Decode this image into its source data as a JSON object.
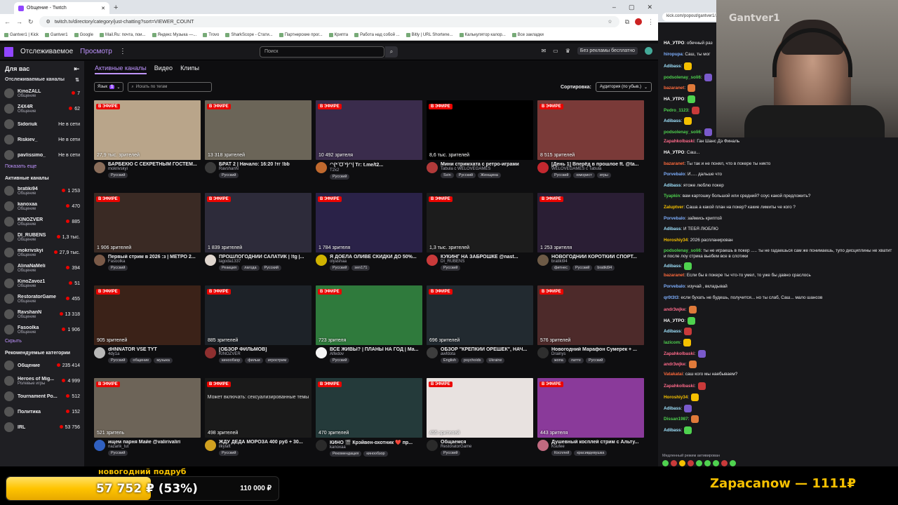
{
  "browser": {
    "tab_title": "Общение - Twitch",
    "url": "twitch.tv/directory/category/just-chatting?sort=VIEWER_COUNT",
    "bookmarks": [
      "Gantver1 | Kick",
      "Gantver1",
      "Google",
      "Mail.Ru: почта, пои...",
      "Яндекс Музыка —...",
      "Trovo",
      "SharkScope - Стати...",
      "Партнерские прог...",
      "Крипта",
      "Работа над собой ...",
      "Bitly | URL Shortene...",
      "Калькулятор калор...",
      "Все закладки"
    ]
  },
  "topnav": {
    "following": "Отслеживаемое",
    "browse": "Просмотр",
    "more": "⋮",
    "search_placeholder": "Поиск",
    "noads": "Без рекламы бесплатно"
  },
  "sidebar": {
    "for_you": "Для вас",
    "followed_header": "Отслеживаемые каналы",
    "followed": [
      {
        "name": "KinoZALL",
        "cat": "Общение",
        "val": "7",
        "live": true
      },
      {
        "name": "Z4X4R",
        "cat": "Общение",
        "val": "62",
        "live": true
      },
      {
        "name": "Sidoriuk",
        "cat": "",
        "val": "Не в сети",
        "live": false
      },
      {
        "name": "Riskiev_",
        "cat": "",
        "val": "Не в сети",
        "live": false
      },
      {
        "name": "pavlissimo_",
        "cat": "",
        "val": "Не в сети",
        "live": false
      }
    ],
    "show_more": "Показать еще",
    "active_header": "Активные каналы",
    "active": [
      {
        "name": "bratiki94",
        "cat": "Общение",
        "val": "1 253"
      },
      {
        "name": "kanoxaa",
        "cat": "Общение",
        "val": "470"
      },
      {
        "name": "KINOZVER",
        "cat": "Общение",
        "val": "885"
      },
      {
        "name": "DI_RUBENS",
        "cat": "Общение",
        "val": "1,3 тыс."
      },
      {
        "name": "mokrivskyi",
        "cat": "Общение",
        "val": "27,9 тыс."
      },
      {
        "name": "AlinaNaMeli",
        "cat": "Общение",
        "val": "394"
      },
      {
        "name": "KinoZavoz1",
        "cat": "Общение",
        "val": "51"
      },
      {
        "name": "RestoratorGame",
        "cat": "Общение",
        "val": "455"
      },
      {
        "name": "RavshanN",
        "cat": "Общение",
        "val": "13 318"
      },
      {
        "name": "Fasoolka",
        "cat": "Общение",
        "val": "1 906"
      }
    ],
    "hide": "Скрыть",
    "rec_header": "Рекомендуемые категории",
    "rec": [
      {
        "name": "Общение",
        "cat": "",
        "val": "235 414"
      },
      {
        "name": "Heroes of Mig...",
        "cat": "Ролевые игры",
        "val": "4 999"
      },
      {
        "name": "Tournament Po...",
        "cat": "",
        "val": "512"
      },
      {
        "name": "Политика",
        "cat": "",
        "val": "152"
      },
      {
        "name": "IRL",
        "cat": "",
        "val": "53 756"
      }
    ]
  },
  "main": {
    "tabs": [
      "Активные каналы",
      "Видео",
      "Клипы"
    ],
    "lang_label": "Язык",
    "lang_count": "1",
    "tag_placeholder": "Искать по тегам",
    "sort_label": "Сортировка:",
    "sort_value": "Аудитория (по убыв.)",
    "live_label": "В ЭФИРЕ",
    "mature_notice": "Может включать: сексуализированные темы",
    "cards": [
      {
        "viewers": "27,9 тыс. зрителей",
        "title": "БАРБЕКЮ С СЕКРЕТНЫМ ГОСТЕМ...",
        "channel": "mokrivskyi",
        "tags": [
          "Русский"
        ],
        "bg": "#b9a58a",
        "av": "#8a6d5a"
      },
      {
        "viewers": "13 318 зрителей",
        "title": "БРАТ 2 | Начало: 16:20 !тг !bb",
        "channel": "RavshanN",
        "tags": [
          "Русский"
        ],
        "bg": "#6b6558",
        "av": "#3a3a3a"
      },
      {
        "viewers": "10 492 зрителя",
        "title": "ᐟᐠ(*ˊᗜˋ*)ᐟᐠ| Тг: t.me/t2...",
        "channel": "T2x2",
        "tags": [
          "Русский"
        ],
        "bg": "#3a2c4c",
        "av": "#c0692e"
      },
      {
        "viewers": "8,6 тыс. зрителей",
        "title": "Мини стримхата с ретро-играми",
        "channel": "Tabula с WELOVEGAMES",
        "tags": [
          "Svin",
          "Русский",
          "Женщина"
        ],
        "bg": "#000000",
        "av": "#b23a3a"
      },
      {
        "viewers": "8 515 зрителей",
        "title": "[День 1] Вперёд в прошлое ft. @ta...",
        "channel": "WELOVEGAMES с Tabula",
        "tags": [
          "Русский",
          "юморист",
          "игры"
        ],
        "bg": "#7a3a38",
        "av": "#c3282f"
      },
      {
        "viewers": "1 906 зрителей",
        "title": "Первый стрим в 2026 :з | МЕТРО 2...",
        "channel": "Fasoolka",
        "tags": [
          "Русский"
        ],
        "bg": "#3a2a24",
        "av": "#7a5a48"
      },
      {
        "viewers": "1 839 зрителей",
        "title": "ПРОШЛОГОДНИЙ САЛАТИК | !tg |...",
        "channel": "lagoda1337",
        "tags": [
          "Реакция",
          "лагода",
          "Русский"
        ],
        "bg": "#2d2b3a",
        "av": "#e0d6cf"
      },
      {
        "viewers": "1 784 зрителя",
        "title": "Я ДОЕЛА ОЛИВЕ СКИДКИ ДО 50%...",
        "channel": "olyashaa",
        "tags": [
          "Русский",
          "sen171"
        ],
        "bg": "#2a2248",
        "av": "#d0b200"
      },
      {
        "viewers": "1,3 тыс. зрителей",
        "title": "КУКИНГ НА ЗАБРОШКЕ @nast...",
        "channel": "DI_RUBENS",
        "tags": [
          "Русский"
        ],
        "bg": "#1c1c1c",
        "av": "#c93a3a"
      },
      {
        "viewers": "1 253 зрителя",
        "title": "НОВОГОДНИЙ КОРОТКИЙ СПОРТ...",
        "channel": "bratiki94",
        "tags": [
          "фитнес",
          "Русский",
          "bratiki94"
        ],
        "bg": "#2a1e34",
        "av": "#6d5a46"
      },
      {
        "viewers": "905 зрителей",
        "title": "dHNNATOR VSE TYT",
        "channel": "4dy1a",
        "tags": [
          "Русский",
          "общение",
          "музыка"
        ],
        "bg": "#3b2218",
        "av": "#b8b8b8"
      },
      {
        "viewers": "885 зрителей",
        "title": "[ОБЗОР ФИЛЬМОВ]",
        "channel": "KINOZVER",
        "tags": [
          "кинообзор",
          "фильм",
          "игрострим"
        ],
        "bg": "#1d2228",
        "av": "#8e2f2f"
      },
      {
        "viewers": "723 зрителя",
        "title": "ВСЕ ЖИВЫ? | ПЛАНЫ НА ГОД | Ма...",
        "channel": "Alfedov",
        "tags": [
          "Русский"
        ],
        "bg": "#2f7a3c",
        "av": "#f5f5f5"
      },
      {
        "viewers": "696 зрителей",
        "title": "ОБЗОР \"КРЕПКИЙ ОРЕШЕК\", НАЧ...",
        "channel": "awfdota",
        "tags": [
          "English",
          "psychoids",
          "Ukraine"
        ],
        "bg": "#222a30",
        "av": "#3d3d3d"
      },
      {
        "viewers": "576 зрителей",
        "title": "Новогодний Марафон Сумерек + ...",
        "channel": "Drainys",
        "tags": [
          "жопа",
          "латте",
          "Русский"
        ],
        "bg": "#4d2a2a",
        "av": "#2e2e2e"
      },
      {
        "viewers": "521 зритель",
        "title": "ищем парня Майе @valirivalirі",
        "channel": "nazarik_tut",
        "tags": [
          "Русский"
        ],
        "bg": "#6d6458",
        "av": "#3060c0"
      },
      {
        "viewers": "498 зрителей",
        "title": "ЖДУ ДЕДА МОРОЗА 400 руб + 30...",
        "channel": "ilkylaft",
        "tags": [
          "Русский"
        ],
        "bg": "#1a1a1a",
        "av": "#d0a020",
        "mature": true
      },
      {
        "viewers": "470 зрителей",
        "title": "КИНО 🎬 Крэйвен-охотник ❤️ пр...",
        "channel": "kanoxaa",
        "tags": [
          "Рекомендация",
          "кинообзор"
        ],
        "bg": "#243a3a",
        "av": "#2a2a2a"
      },
      {
        "viewers": "455 зрителей",
        "title": "Общаемся",
        "channel": "RestoratorGame",
        "tags": [
          "Русский"
        ],
        "bg": "#e8e2e0",
        "av": "#2a2a2a"
      },
      {
        "viewers": "443 зрителя",
        "title": "Душевный косплей стрим с Альту...",
        "channel": "Ksufee",
        "tags": [
          "Косплей",
          "красивдевушка"
        ],
        "bg": "#8a3a9a",
        "av": "#c06a80"
      }
    ]
  },
  "popout": {
    "url": "kick.com/popout/gantver1/...",
    "cam_label": "Gantver1"
  },
  "chat": [
    {
      "user": "НА_УТРО",
      "color": "#ffffff",
      "text": ": обечный раз"
    },
    {
      "user": "hiropupa",
      "color": "#7fb0ff",
      "text": ": Саш, ты мог"
    },
    {
      "user": "Adibass",
      "color": "#a0e4ff",
      "text": ":"
    },
    {
      "user": "podsolenay_soli6",
      "color": "#4fd24f",
      "text": ":"
    },
    {
      "user": "bazaranet",
      "color": "#ff6a3c",
      "text": ":"
    },
    {
      "user": "НА_УТРО",
      "color": "#ffffff",
      "text": ":"
    },
    {
      "user": "Pedro_1123",
      "color": "#4fd24f",
      "text": ":"
    },
    {
      "user": "Adibass",
      "color": "#a0e4ff",
      "text": ":"
    },
    {
      "user": "podsolenay_soli6",
      "color": "#4fd24f",
      "text": ":"
    },
    {
      "user": "Zapahkolbaski",
      "color": "#ff6a8a",
      "text": ": Ган Шанс Дэ Финаль"
    },
    {
      "user": "НА_УТРО",
      "color": "#ffffff",
      "text": ": Саш..."
    },
    {
      "user": "bazaranet",
      "color": "#ff6a3c",
      "text": ": Ты так и не понял, что в покере ты никто"
    },
    {
      "user": "Porvebalo",
      "color": "#7fb0ff",
      "text": ": И..... дальше что"
    },
    {
      "user": "Adibass",
      "color": "#a0e4ff",
      "text": ": ятоже люблю покер"
    },
    {
      "user": "Tyapkin",
      "color": "#4fd24f",
      "text": ": вам картошку большой или средний? соус какой предложить?"
    },
    {
      "user": "Zaluptver",
      "color": "#f5c000",
      "text": ": Саша а какой план на покер? какие лимиты че кого ?"
    },
    {
      "user": "Porvebalo",
      "color": "#7fb0ff",
      "text": ": займись криптой"
    },
    {
      "user": "Adibass",
      "color": "#a0e4ff",
      "text": ": И ТЕБЯ ЛЮБЛЮ"
    },
    {
      "user": "Horoshiy34",
      "color": "#f5c000",
      "text": ": 2026 распланирован"
    },
    {
      "user": "podsolenay_soli6",
      "color": "#4fd24f",
      "text": ": ты не играешь в покер ..... ты не гадаешься сам же понимаешь, тупо дисциплины не хватит и после лоу стрика вьебем все в слотики"
    },
    {
      "user": "Adibass",
      "color": "#a0e4ff",
      "text": ":"
    },
    {
      "user": "bazaranet",
      "color": "#ff6a3c",
      "text": ": Если бы в покере ты что-то умел, то уже бы давно сраслось"
    },
    {
      "user": "Porvebalo",
      "color": "#7fb0ff",
      "text": ": изучай , вкладывай"
    },
    {
      "user": "qr0t3t3",
      "color": "#7fb0ff",
      "text": ": если бухать не будешь, получится... но ты слаб, Саш... мало шансов"
    },
    {
      "user": "andr3wjke",
      "color": "#ff6a8a",
      "text": ":"
    },
    {
      "user": "НА_УТРО",
      "color": "#ffffff",
      "text": ":"
    },
    {
      "user": "Adibass",
      "color": "#a0e4ff",
      "text": ":"
    },
    {
      "user": "lazicom",
      "color": "#4fd24f",
      "text": ":"
    },
    {
      "user": "Zapahkolbaski",
      "color": "#ff6a8a",
      "text": ":"
    },
    {
      "user": "andr3wjke",
      "color": "#ff6a8a",
      "text": ":"
    },
    {
      "user": "Vatakatai",
      "color": "#ff6a3c",
      "text": ": саш кого мы наебываем?"
    },
    {
      "user": "Zapahkolbaski",
      "color": "#ff6a8a",
      "text": ":"
    },
    {
      "user": "Horoshiy34",
      "color": "#f5c000",
      "text": ":"
    },
    {
      "user": "Adibass",
      "color": "#a0e4ff",
      "text": ":"
    },
    {
      "user": "Dissan1987",
      "color": "#4fd24f",
      "text": ":"
    },
    {
      "user": "Adibass",
      "color": "#a0e4ff",
      "text": ":"
    }
  ],
  "chat_footer": "Медленный режим активирован",
  "goal": {
    "title": "новогодний подруб",
    "current": "57 752 ₽ (53%)",
    "max": "110 000 ₽",
    "percent": 53
  },
  "ticker": "Zapacanow — 1111₽"
}
